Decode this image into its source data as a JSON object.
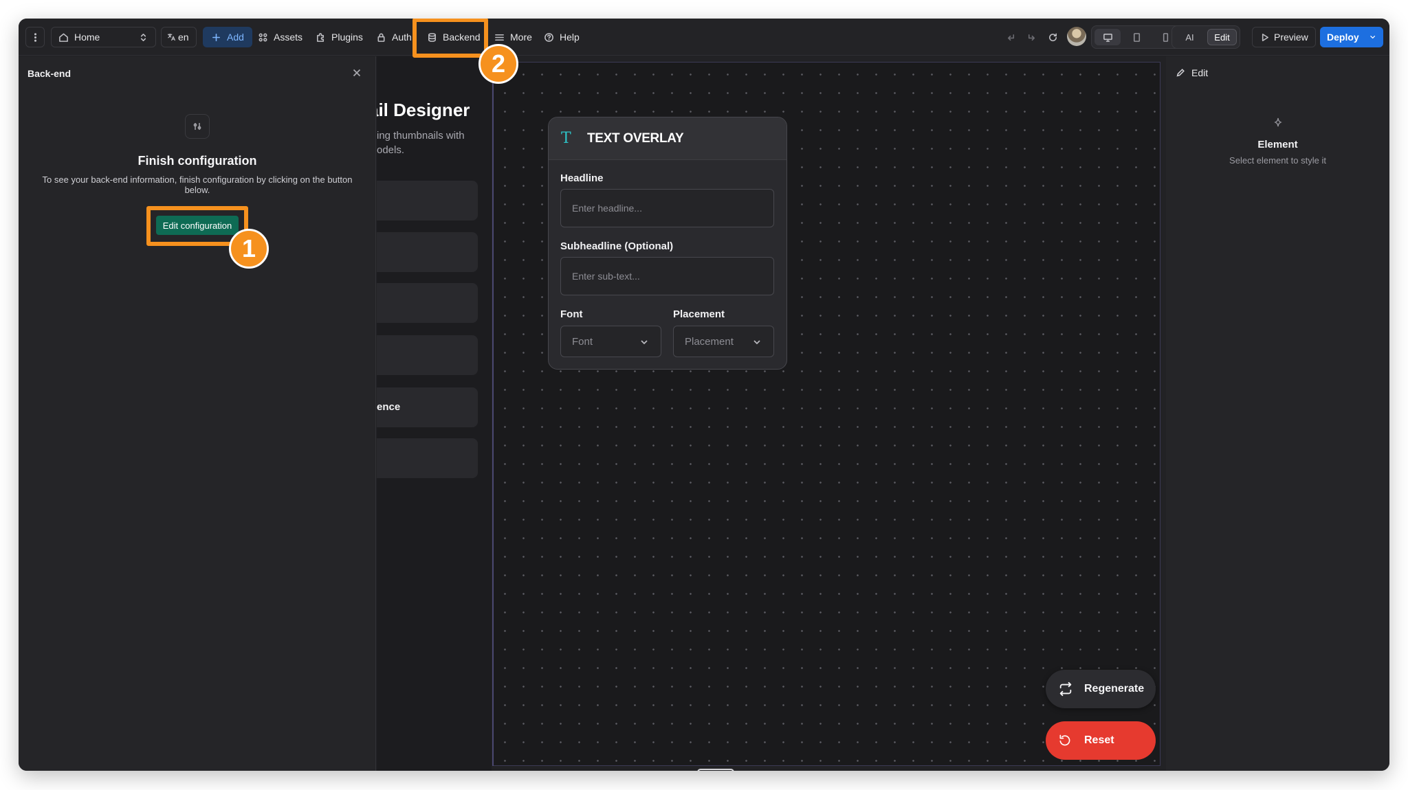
{
  "topbar": {
    "home_label": "Home",
    "language_label": "en",
    "add_label": "Add",
    "assets_label": "Assets",
    "plugins_label": "Plugins",
    "auth_label": "Auth",
    "backend_label": "Backend",
    "more_label": "More",
    "help_label": "Help",
    "ai_label": "AI",
    "edit_mode_label": "Edit",
    "preview_label": "Preview",
    "deploy_label": "Deploy"
  },
  "annotations": {
    "step1": "1",
    "step2": "2",
    "color": "#f6911e"
  },
  "left_panel": {
    "title": "Back-end",
    "heading": "Finish configuration",
    "description": "To see your back-end information, finish configuration by clicking on the button below.",
    "button_label": "Edit configuration"
  },
  "app_preview": {
    "heading": "ail Designer",
    "subtitle_line1": "ing thumbnails with",
    "subtitle_line2": "odels.",
    "card_label": "ence"
  },
  "overlay": {
    "title": "TEXT OVERLAY",
    "icon_glyph": "T",
    "headline_label": "Headline",
    "headline_placeholder": "Enter headline...",
    "subheadline_label": "Subheadline (Optional)",
    "subheadline_placeholder": "Enter sub-text...",
    "font_label": "Font",
    "font_value": "Font",
    "placement_label": "Placement",
    "placement_value": "Placement"
  },
  "actions": {
    "regenerate_label": "Regenerate",
    "reset_label": "Reset"
  },
  "right_panel": {
    "edit_label": "Edit",
    "title": "Element",
    "subtitle": "Select element to style it"
  },
  "colors": {
    "accent_blue": "#1d6fe0",
    "config_green": "#0e6b54",
    "reset_red": "#e63a2f",
    "overlay_teal": "#2ec4c9"
  }
}
